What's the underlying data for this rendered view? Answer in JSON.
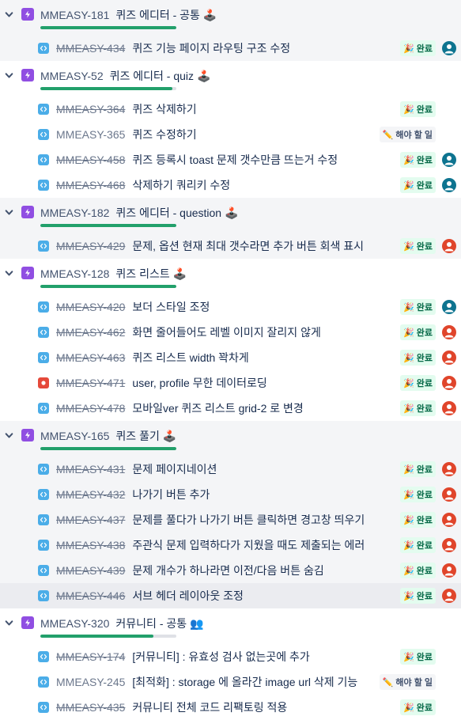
{
  "colors": {
    "epic_icon": "#904ee2",
    "task_icon": "#4bade8",
    "bug_icon": "#e5493a",
    "progress_fill": "#22a06b",
    "status_done_bg": "#e3fcef",
    "avatar_teal": "#0e7490",
    "avatar_orange": "#e0452b"
  },
  "epics": [
    {
      "key": "MMEASY-181",
      "title": "퀴즈 에디터 - 공통",
      "emoji": "🕹️",
      "progress": 1.0,
      "issues": [
        {
          "key": "MMEASY-434",
          "summary": "퀴즈 기능 페이지 라우팅 구조 수정",
          "type": "task",
          "done": true,
          "status_glyph": "🎉",
          "status": "완료",
          "avatar": "teal"
        }
      ]
    },
    {
      "key": "MMEASY-52",
      "title": "퀴즈 에디터 - quiz",
      "emoji": "🕹️",
      "progress": 0.97,
      "issues": [
        {
          "key": "MMEASY-364",
          "summary": "퀴즈 삭제하기",
          "type": "task",
          "done": true,
          "status_glyph": "🎉",
          "status": "완료",
          "avatar": "none"
        },
        {
          "key": "MMEASY-365",
          "summary": "퀴즈 수정하기",
          "type": "task",
          "done": false,
          "status_glyph": "✏️",
          "status": "해야 할 일",
          "avatar": "none"
        },
        {
          "key": "MMEASY-458",
          "summary": "퀴즈 등록시 toast 문제 갯수만큼 뜨는거 수정",
          "type": "task",
          "done": true,
          "status_glyph": "🎉",
          "status": "완료",
          "avatar": "teal"
        },
        {
          "key": "MMEASY-468",
          "summary": "삭제하기 쿼리키 수정",
          "type": "task",
          "done": true,
          "status_glyph": "🎉",
          "status": "완료",
          "avatar": "teal"
        }
      ]
    },
    {
      "key": "MMEASY-182",
      "title": "퀴즈 에디터 - question",
      "emoji": "🕹️",
      "progress": 1.0,
      "issues": [
        {
          "key": "MMEASY-429",
          "summary": "문제, 옵션 현재 최대 갯수라면 추가 버튼 회색 표시",
          "type": "task",
          "done": true,
          "status_glyph": "🎉",
          "status": "완료",
          "avatar": "orange"
        }
      ]
    },
    {
      "key": "MMEASY-128",
      "title": "퀴즈 리스트",
      "emoji": "🕹️",
      "progress": 1.0,
      "issues": [
        {
          "key": "MMEASY-420",
          "summary": "보더 스타일 조정",
          "type": "task",
          "done": true,
          "status_glyph": "🎉",
          "status": "완료",
          "avatar": "teal"
        },
        {
          "key": "MMEASY-462",
          "summary": "화면 줄어들어도 레벨 이미지 잘리지 않게",
          "type": "task",
          "done": true,
          "status_glyph": "🎉",
          "status": "완료",
          "avatar": "orange"
        },
        {
          "key": "MMEASY-463",
          "summary": "퀴즈 리스트 width 꽉차게",
          "type": "task",
          "done": true,
          "status_glyph": "🎉",
          "status": "완료",
          "avatar": "orange"
        },
        {
          "key": "MMEASY-471",
          "summary": "user, profile 무한 데이터로딩",
          "type": "bug",
          "done": true,
          "status_glyph": "🎉",
          "status": "완료",
          "avatar": "orange"
        },
        {
          "key": "MMEASY-478",
          "summary": "모바일ver 퀴즈 리스트 grid-2 로 변경",
          "type": "task",
          "done": true,
          "status_glyph": "🎉",
          "status": "완료",
          "avatar": "orange"
        }
      ]
    },
    {
      "key": "MMEASY-165",
      "title": "퀴즈 풀기",
      "emoji": "🕹️",
      "progress": 1.0,
      "issues": [
        {
          "key": "MMEASY-431",
          "summary": "문제 페이지네이션",
          "type": "task",
          "done": true,
          "status_glyph": "🎉",
          "status": "완료",
          "avatar": "orange"
        },
        {
          "key": "MMEASY-432",
          "summary": "나가기 버튼 추가",
          "type": "task",
          "done": true,
          "status_glyph": "🎉",
          "status": "완료",
          "avatar": "orange"
        },
        {
          "key": "MMEASY-437",
          "summary": "문제를 풀다가 나가기 버튼 클릭하면 경고창 띄우기",
          "type": "task",
          "done": true,
          "status_glyph": "🎉",
          "status": "완료",
          "avatar": "orange"
        },
        {
          "key": "MMEASY-438",
          "summary": "주관식 문제 입력하다가 지웠을 때도 제출되는 에러",
          "type": "task",
          "done": true,
          "status_glyph": "🎉",
          "status": "완료",
          "avatar": "orange"
        },
        {
          "key": "MMEASY-439",
          "summary": "문제 개수가 하나라면 이전/다음 버튼 숨김",
          "type": "task",
          "done": true,
          "status_glyph": "🎉",
          "status": "완료",
          "avatar": "orange"
        },
        {
          "key": "MMEASY-446",
          "summary": "서브 헤더 레이아웃 조정",
          "type": "task",
          "done": true,
          "status_glyph": "🎉",
          "status": "완료",
          "avatar": "orange",
          "hover": true
        }
      ]
    },
    {
      "key": "MMEASY-320",
      "title": "커뮤니티 - 공통",
      "emoji": "👥",
      "progress": 0.83,
      "issues": [
        {
          "key": "MMEASY-174",
          "summary": "[커뮤니티] : 유효성 검사 없는곳에 추가",
          "type": "task",
          "done": true,
          "status_glyph": "🎉",
          "status": "완료",
          "avatar": "none"
        },
        {
          "key": "MMEASY-245",
          "summary": "[최적화] : storage 에 올라간 image url 삭제 기능",
          "type": "task",
          "done": false,
          "status_glyph": "✏️",
          "status": "해야 할 일",
          "avatar": "none"
        },
        {
          "key": "MMEASY-435",
          "summary": "커뮤니티 전체 코드 리팩토링 적용",
          "type": "task",
          "done": true,
          "status_glyph": "🎉",
          "status": "완료",
          "avatar": "none"
        }
      ]
    }
  ]
}
